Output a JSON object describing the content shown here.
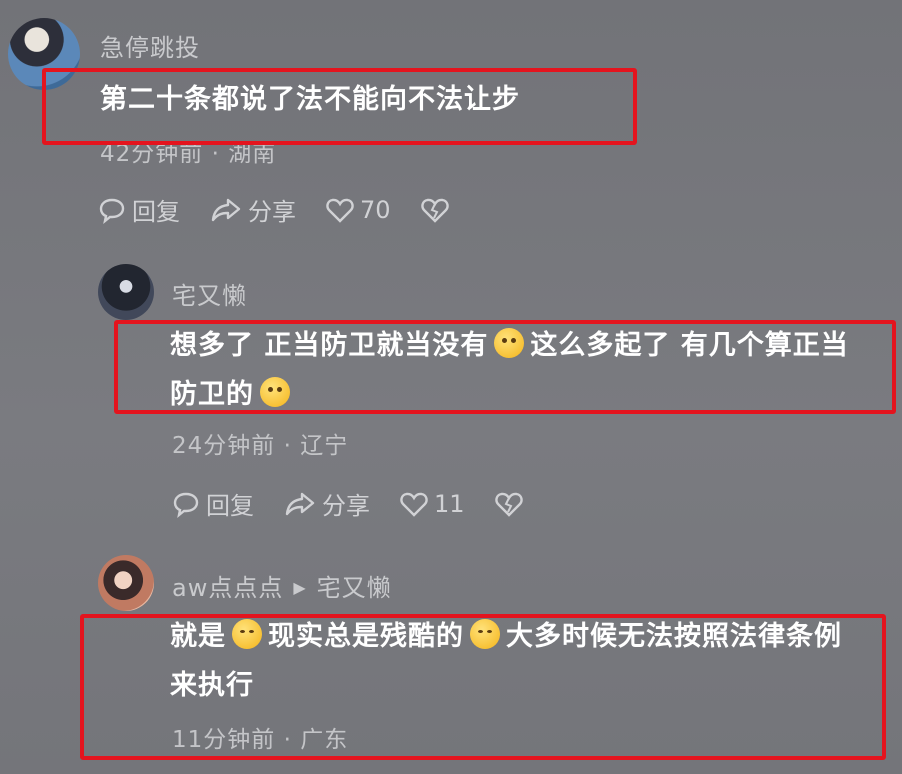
{
  "comments": [
    {
      "user": "急停跳投",
      "text": "第二十条都说了法不能向不法让步",
      "meta": "42分钟前 · 湖南",
      "reply_label": "回复",
      "share_label": "分享",
      "likes": "70"
    },
    {
      "user": "宅又懒",
      "text_line1_a": "想多了 正当防卫就当没有",
      "text_line1_b": "这么多起了 有几个算正当",
      "text_line2": "防卫的",
      "meta": "24分钟前 · 辽宁",
      "reply_label": "回复",
      "share_label": "分享",
      "likes": "11"
    },
    {
      "user": "aw点点点",
      "reply_to": "宅又懒",
      "text_line1_a": "就是",
      "text_line1_b": "现实总是残酷的",
      "text_line1_c": "大多时候无法按照法律条例",
      "text_line2": "来执行",
      "meta": "11分钟前 · 广东"
    }
  ],
  "colors": {
    "highlight_box": "#e4141e",
    "background": "#76777c"
  },
  "icons": [
    "reply-icon",
    "share-icon",
    "heart-icon",
    "broken-heart-icon"
  ]
}
